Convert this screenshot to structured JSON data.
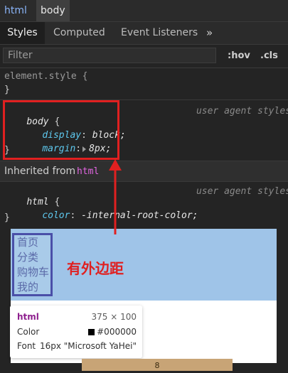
{
  "breadcrumb": {
    "html": "html",
    "body": "body"
  },
  "tabs": {
    "styles": "Styles",
    "computed": "Computed",
    "events": "Event Listeners",
    "more": "»"
  },
  "filter": {
    "placeholder": "Filter",
    "hov": ":hov",
    "cls": ".cls"
  },
  "element_style": {
    "selector": "element.style {",
    "close": "}"
  },
  "body_rule": {
    "selector": "body",
    "open": " {",
    "origin": "user agent styles",
    "decl1_prop": "display",
    "decl1_val": "block;",
    "decl2_prop": "margin",
    "decl2_val": "8px;",
    "close": "}"
  },
  "inherited": {
    "label": "Inherited from",
    "tag": "html"
  },
  "html_rule": {
    "selector": "html",
    "open": " {",
    "origin": "user agent styles",
    "decl1_prop": "color",
    "decl1_val": "-internal-root-color;",
    "close": "}"
  },
  "preview": {
    "items": [
      "首页",
      "分类",
      "购物车",
      "我的"
    ]
  },
  "annotation": "有外边距",
  "tooltip": {
    "tag": "html",
    "size": "375 × 100",
    "color_label": "Color",
    "color_value": "#000000",
    "font_label": "Font",
    "font_value": "16px \"Microsoft YaHei\""
  },
  "margin_value": "8",
  "colors": {
    "annotation_red": "#e02020",
    "preview_blue": "#9fc4e8"
  }
}
